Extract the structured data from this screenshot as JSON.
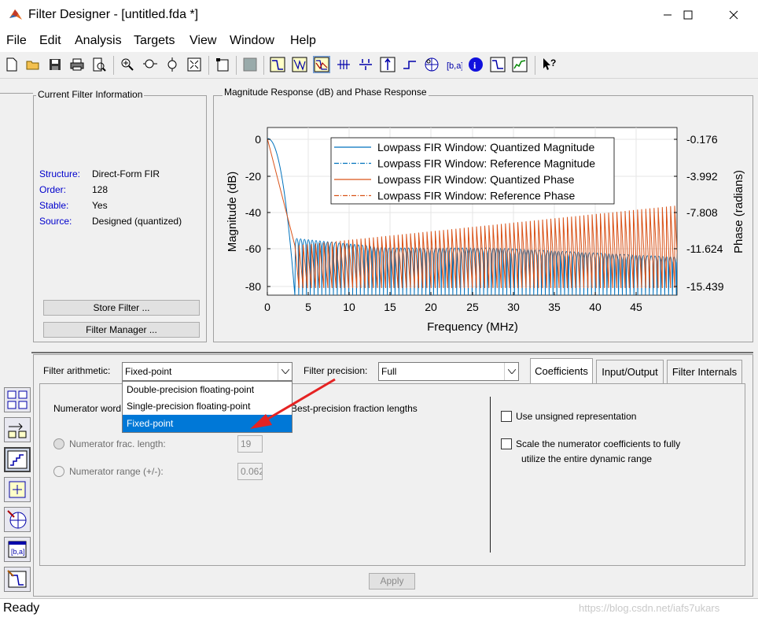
{
  "window": {
    "title": "Filter Designer -  [untitled.fda *]"
  },
  "menu": [
    "File",
    "Edit",
    "Analysis",
    "Targets",
    "View",
    "Window",
    "Help"
  ],
  "info": {
    "group_title": "Current Filter Information",
    "rows": [
      {
        "label": "Structure:",
        "value": "Direct-Form FIR"
      },
      {
        "label": "Order:",
        "value": "128"
      },
      {
        "label": "Stable:",
        "value": "Yes"
      },
      {
        "label": "Source:",
        "value": "Designed (quantized)"
      }
    ],
    "store_button": "Store Filter ...",
    "manager_button": "Filter Manager ..."
  },
  "plot": {
    "group_title": "Magnitude Response (dB) and Phase Response",
    "ylabel": "Magnitude (dB)",
    "y2label": "Phase (radians)",
    "xlabel": "Frequency (MHz)",
    "yticks": [
      "0",
      "-20",
      "-40",
      "-60",
      "-80"
    ],
    "y2ticks": [
      "-0.176",
      "-3.992",
      "-7.808",
      "-11.624",
      "-15.439"
    ],
    "xticks": [
      "0",
      "5",
      "10",
      "15",
      "20",
      "25",
      "30",
      "35",
      "40",
      "45"
    ],
    "legend": [
      {
        "text": "Lowpass FIR Window: Quantized Magnitude",
        "color": "#0072bd",
        "dash": "none"
      },
      {
        "text": "Lowpass FIR Window: Reference Magnitude",
        "color": "#0072bd",
        "dash": "6,2,1,2"
      },
      {
        "text": "Lowpass FIR Window: Quantized Phase",
        "color": "#d95319",
        "dash": "none"
      },
      {
        "text": "Lowpass FIR Window: Reference Phase",
        "color": "#d95319",
        "dash": "6,2,1,2"
      }
    ]
  },
  "arith": {
    "label": "Filter arithmetic:",
    "value": "Fixed-point",
    "options": [
      "Double-precision floating-point",
      "Single-precision floating-point",
      "Fixed-point"
    ],
    "selected_index": 2
  },
  "precision": {
    "label": "Filter precision:",
    "value": "Full"
  },
  "tabs": [
    "Coefficients",
    "Input/Output",
    "Filter Internals"
  ],
  "coeff": {
    "numerator_word_label": "Numerator word",
    "best_precision": "Best-precision fraction lengths",
    "frac_label": "Numerator frac. length:",
    "frac_value": "19",
    "range_label": "Numerator range (+/-):",
    "range_value": "0.062",
    "unsigned_label": "Use unsigned representation",
    "scale_label_1": "Scale the numerator coefficients to fully",
    "scale_label_2": "utilize the entire dynamic range"
  },
  "apply_button": "Apply",
  "status": "Ready",
  "watermark": "https://blog.csdn.net/iafs7ukars"
}
